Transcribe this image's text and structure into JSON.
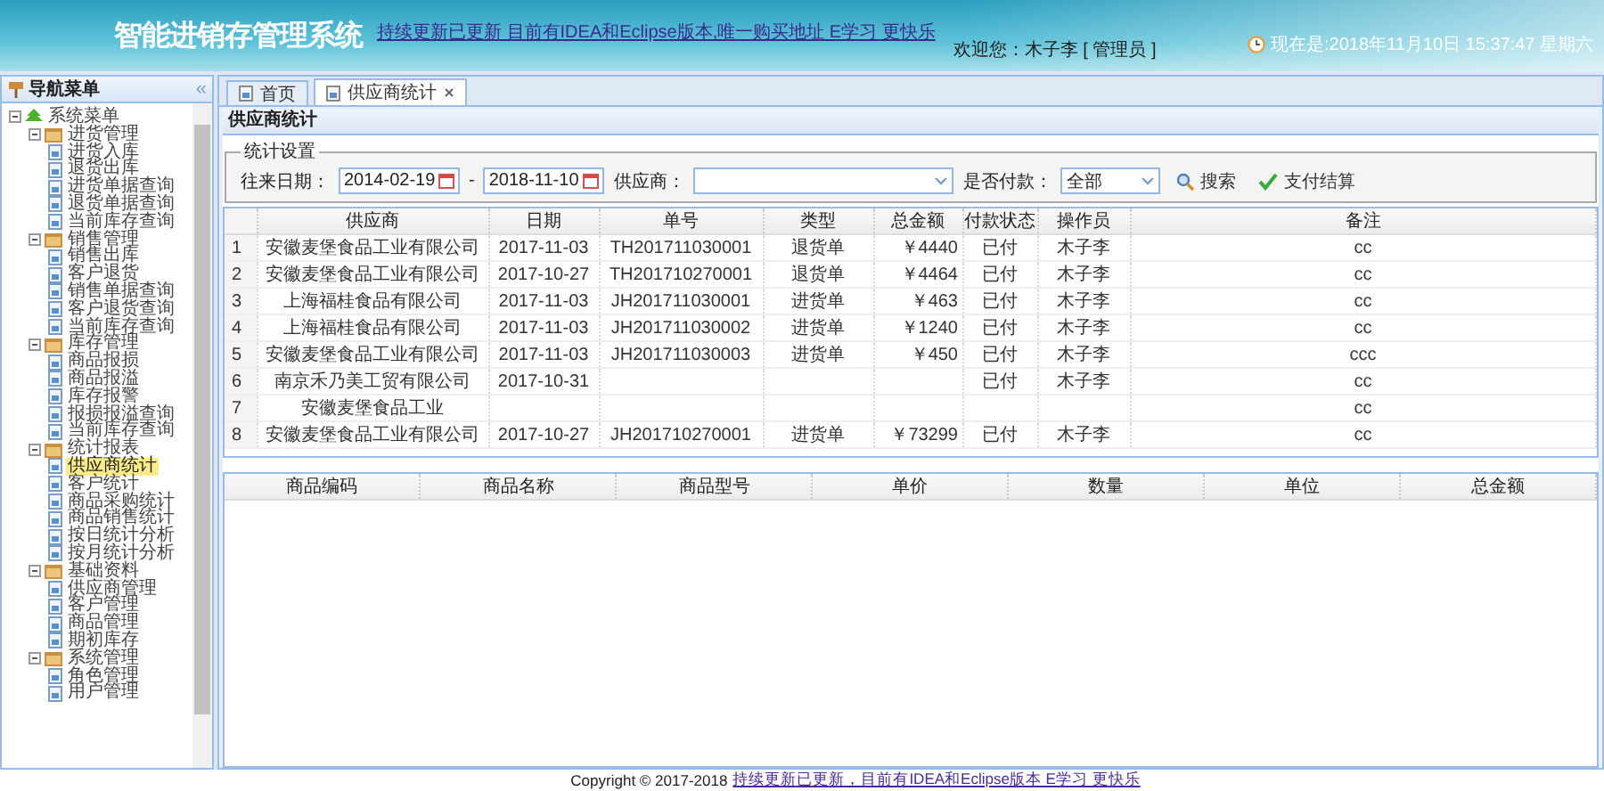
{
  "header": {
    "title": "智能进销存管理系统",
    "notice_link": "持续更新已更新 目前有IDEA和Eclipse版本,唯一购买地址 E学习 更快乐",
    "welcome": "欢迎您：木子李 [ 管理员 ]",
    "clock": "现在是:2018年11月10日 15:37:47 星期六"
  },
  "sidebar": {
    "title": "导航菜单",
    "collapse": "«",
    "tree": [
      {
        "label": "系统菜单",
        "expanded": true,
        "children": [
          {
            "label": "进货管理",
            "expanded": true,
            "children": [
              {
                "label": "进货入库",
                "selected": false
              },
              {
                "label": "退货出库",
                "selected": false
              },
              {
                "label": "进货单据查询",
                "selected": false
              },
              {
                "label": "退货单据查询",
                "selected": false
              },
              {
                "label": "当前库存查询",
                "selected": false
              }
            ]
          },
          {
            "label": "销售管理",
            "expanded": true,
            "children": [
              {
                "label": "销售出库",
                "selected": false
              },
              {
                "label": "客户退货",
                "selected": false
              },
              {
                "label": "销售单据查询",
                "selected": false
              },
              {
                "label": "客户退货查询",
                "selected": false
              },
              {
                "label": "当前库存查询",
                "selected": false
              }
            ]
          },
          {
            "label": "库存管理",
            "expanded": true,
            "children": [
              {
                "label": "商品报损",
                "selected": false
              },
              {
                "label": "商品报溢",
                "selected": false
              },
              {
                "label": "库存报警",
                "selected": false
              },
              {
                "label": "报损报溢查询",
                "selected": false
              },
              {
                "label": "当前库存查询",
                "selected": false
              }
            ]
          },
          {
            "label": "统计报表",
            "expanded": true,
            "children": [
              {
                "label": "供应商统计",
                "selected": true
              },
              {
                "label": "客户统计",
                "selected": false
              },
              {
                "label": "商品采购统计",
                "selected": false
              },
              {
                "label": "商品销售统计",
                "selected": false
              },
              {
                "label": "按日统计分析",
                "selected": false
              },
              {
                "label": "按月统计分析",
                "selected": false
              }
            ]
          },
          {
            "label": "基础资料",
            "expanded": true,
            "children": [
              {
                "label": "供应商管理",
                "selected": false
              },
              {
                "label": "客户管理",
                "selected": false
              },
              {
                "label": "商品管理",
                "selected": false
              },
              {
                "label": "期初库存",
                "selected": false
              }
            ]
          },
          {
            "label": "系统管理",
            "expanded": true,
            "children": [
              {
                "label": "角色管理",
                "selected": false
              },
              {
                "label": "用户管理",
                "selected": false
              }
            ]
          }
        ]
      }
    ]
  },
  "tabs": [
    {
      "label": "首页",
      "selected": false,
      "closable": false
    },
    {
      "label": "供应商统计",
      "selected": true,
      "closable": true
    }
  ],
  "panel_title": "供应商统计",
  "filter": {
    "legend": "统计设置",
    "date_label": "往来日期：",
    "date_from": "2014-02-19",
    "date_sep": "-",
    "date_to": "2018-11-10",
    "supplier_label": "供应商：",
    "paid_label": "是否付款：",
    "paid_value": "全部",
    "buttons": [
      {
        "label": "搜索",
        "kind": "search"
      },
      {
        "label": "支付结算",
        "kind": "check"
      }
    ]
  },
  "table": {
    "columns": [
      "供应商",
      "日期",
      "单号",
      "类型",
      "总金额",
      "付款状态",
      "操作员",
      "备注"
    ],
    "rows": [
      {
        "index": "1",
        "cells": [
          "安徽麦堡食品工业有限公司",
          "2017-11-03",
          "TH201711030001",
          "退货单",
          "￥4440",
          "已付",
          "木子李",
          "cc"
        ]
      },
      {
        "index": "2",
        "cells": [
          "安徽麦堡食品工业有限公司",
          "2017-10-27",
          "TH201710270001",
          "退货单",
          "￥4464",
          "已付",
          "木子李",
          "cc"
        ]
      },
      {
        "index": "3",
        "cells": [
          "上海福桂食品有限公司",
          "2017-11-03",
          "JH201711030001",
          "进货单",
          "￥463",
          "已付",
          "木子李",
          "cc"
        ]
      },
      {
        "index": "4",
        "cells": [
          "上海福桂食品有限公司",
          "2017-11-03",
          "JH201711030002",
          "进货单",
          "￥1240",
          "已付",
          "木子李",
          "cc"
        ]
      },
      {
        "index": "5",
        "cells": [
          "安徽麦堡食品工业有限公司",
          "2017-11-03",
          "JH201711030003",
          "进货单",
          "￥450",
          "已付",
          "木子李",
          "ccc"
        ]
      },
      {
        "index": "6",
        "cells": [
          "南京禾乃美工贸有限公司",
          "2017-10-31",
          "",
          "",
          "",
          "已付",
          "木子李",
          "cc"
        ]
      },
      {
        "index": "7",
        "cells": [
          "安徽麦堡食品工业",
          "",
          "",
          "",
          "",
          "",
          "",
          "cc"
        ]
      },
      {
        "index": "8",
        "cells": [
          "安徽麦堡食品工业有限公司",
          "2017-10-27",
          "JH201710270001",
          "进货单",
          "￥73299",
          "已付",
          "木子李",
          "cc"
        ]
      }
    ]
  },
  "detail_table": {
    "columns": [
      "商品编码",
      "商品名称",
      "商品型号",
      "单价",
      "数量",
      "单位",
      "总金额"
    ]
  },
  "footer": {
    "copyright": "Copyright © 2017-2018",
    "link": "持续更新已更新，目前有IDEA和Eclipse版本 E学习 更快乐"
  }
}
